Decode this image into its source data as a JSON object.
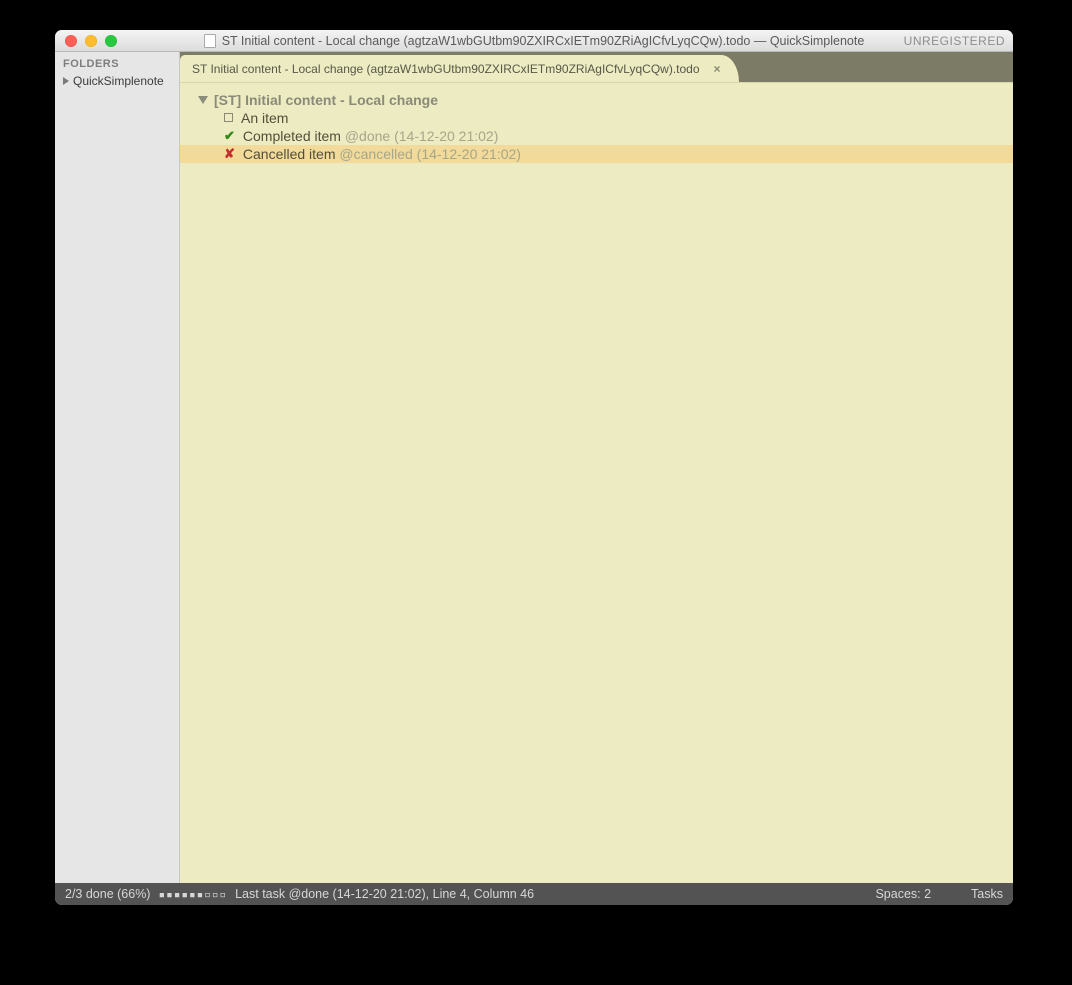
{
  "window": {
    "title": "ST Initial content - Local change (agtzaW1wbGUtbm90ZXIRCxIETm90ZRiAgICfvLyqCQw).todo — QuickSimplenote",
    "unregistered": "UNREGISTERED"
  },
  "sidebar": {
    "heading": "FOLDERS",
    "items": [
      {
        "label": "QuickSimplenote"
      }
    ]
  },
  "tab": {
    "label": "ST Initial content - Local change (agtzaW1wbGUtbm90ZXIRCxIETm90ZRiAgICfvLyqCQw).todo",
    "close": "×"
  },
  "document": {
    "project_title": "[ST] Initial content - Local change",
    "lines": [
      {
        "marker": "box",
        "text": "An item",
        "annotation": "",
        "highlight": false
      },
      {
        "marker": "check",
        "text": "Completed item",
        "annotation": "@done (14-12-20 21:02)",
        "highlight": false
      },
      {
        "marker": "cross",
        "text": "Cancelled item",
        "annotation": "@cancelled (14-12-20 21:02)",
        "highlight": true
      }
    ]
  },
  "statusbar": {
    "left_done": "2/3 done (66%)",
    "progress_glyphs": "▪▪▪▪▪▪▫▫▫",
    "last_task": "Last task @done (14-12-20 21:02), Line 4, Column 46",
    "spaces": "Spaces: 2",
    "syntax": "Tasks"
  }
}
